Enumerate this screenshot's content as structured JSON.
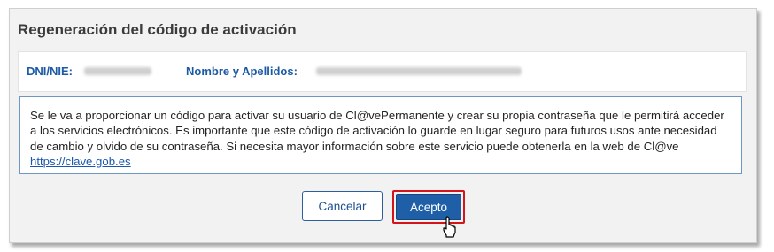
{
  "dialog": {
    "title": "Regeneración del código de activación",
    "id_panel": {
      "dni_label": "DNI/NIE:",
      "name_label": "Nombre y Apellidos:"
    },
    "info": {
      "text": "Se le va a proporcionar un código para activar su usuario de Cl@vePermanente y crear su propia contraseña que le permitirá acceder a los servicios electrónicos. Es importante que este código de activación lo guarde en lugar seguro para futuros usos ante necesidad de cambio y olvido de su contraseña. Si necesita mayor información sobre este servicio puede obtenerla en la web de Cl@ve",
      "link": "https://clave.gob.es"
    },
    "buttons": {
      "cancel": "Cancelar",
      "accept": "Acepto"
    }
  },
  "colors": {
    "accent": "#1e5fa8",
    "highlight": "#d4141b",
    "label_blue": "#1c5aa6"
  },
  "icons": [
    "pointer-cursor-icon"
  ]
}
